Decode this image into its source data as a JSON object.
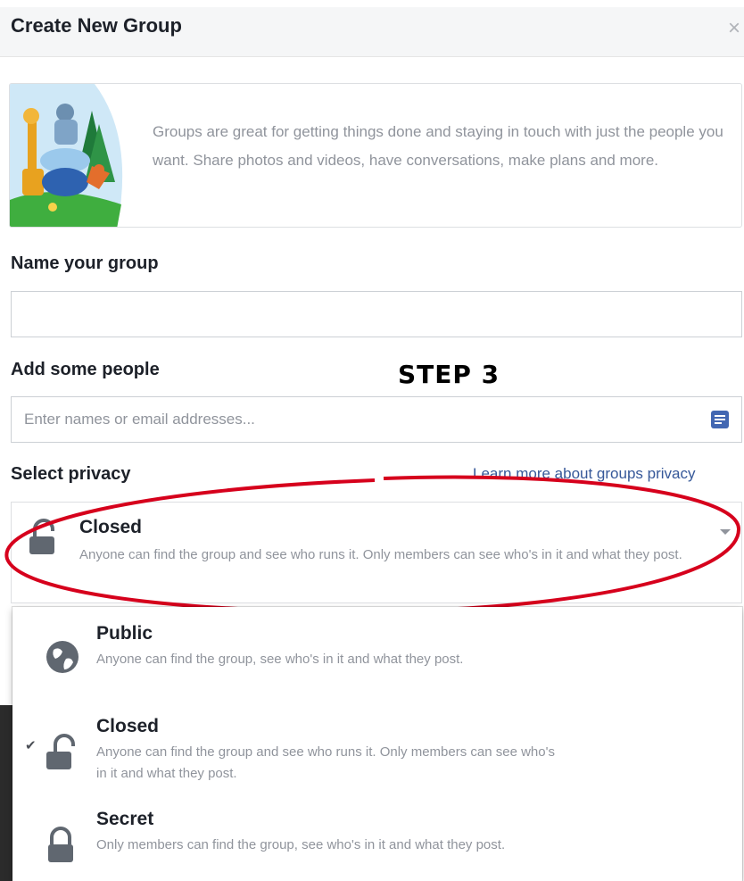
{
  "dialog": {
    "title": "Create New Group",
    "close_glyph": "×"
  },
  "intro": {
    "text": "Groups are great for getting things done and staying in touch with just the people you want. Share photos and videos, have conversations, make plans and more.",
    "illustration": "animals-group-illustration"
  },
  "name_section": {
    "label": "Name your group",
    "value": "",
    "placeholder": ""
  },
  "people_section": {
    "label": "Add some people",
    "value": "",
    "placeholder": "Enter names or email addresses...",
    "icon": "contacts-icon"
  },
  "annotation": {
    "step_label": "STEP 3",
    "highlight_color": "#d6001c"
  },
  "privacy_section": {
    "label": "Select privacy",
    "learn_more": "Learn more about groups privacy",
    "selected": {
      "name": "Closed",
      "description": "Anyone can find the group and see who runs it. Only members can see who's in it and what they post.",
      "icon": "unlocked-padlock-icon"
    },
    "options": [
      {
        "name": "Public",
        "description": "Anyone can find the group, see who's in it and what they post.",
        "icon": "globe-icon",
        "checked": false
      },
      {
        "name": "Closed",
        "description": "Anyone can find the group and see who runs it. Only members can see who's in it and what they post.",
        "icon": "unlocked-padlock-icon",
        "checked": true,
        "check_glyph": "✔"
      },
      {
        "name": "Secret",
        "description": "Only members can find the group, see who's in it and what they post.",
        "icon": "locked-padlock-icon",
        "checked": false
      }
    ]
  },
  "colors": {
    "link": "#365899",
    "secondary_text": "#90949c",
    "primary_text": "#1d2129",
    "icon_gray": "#606770"
  }
}
